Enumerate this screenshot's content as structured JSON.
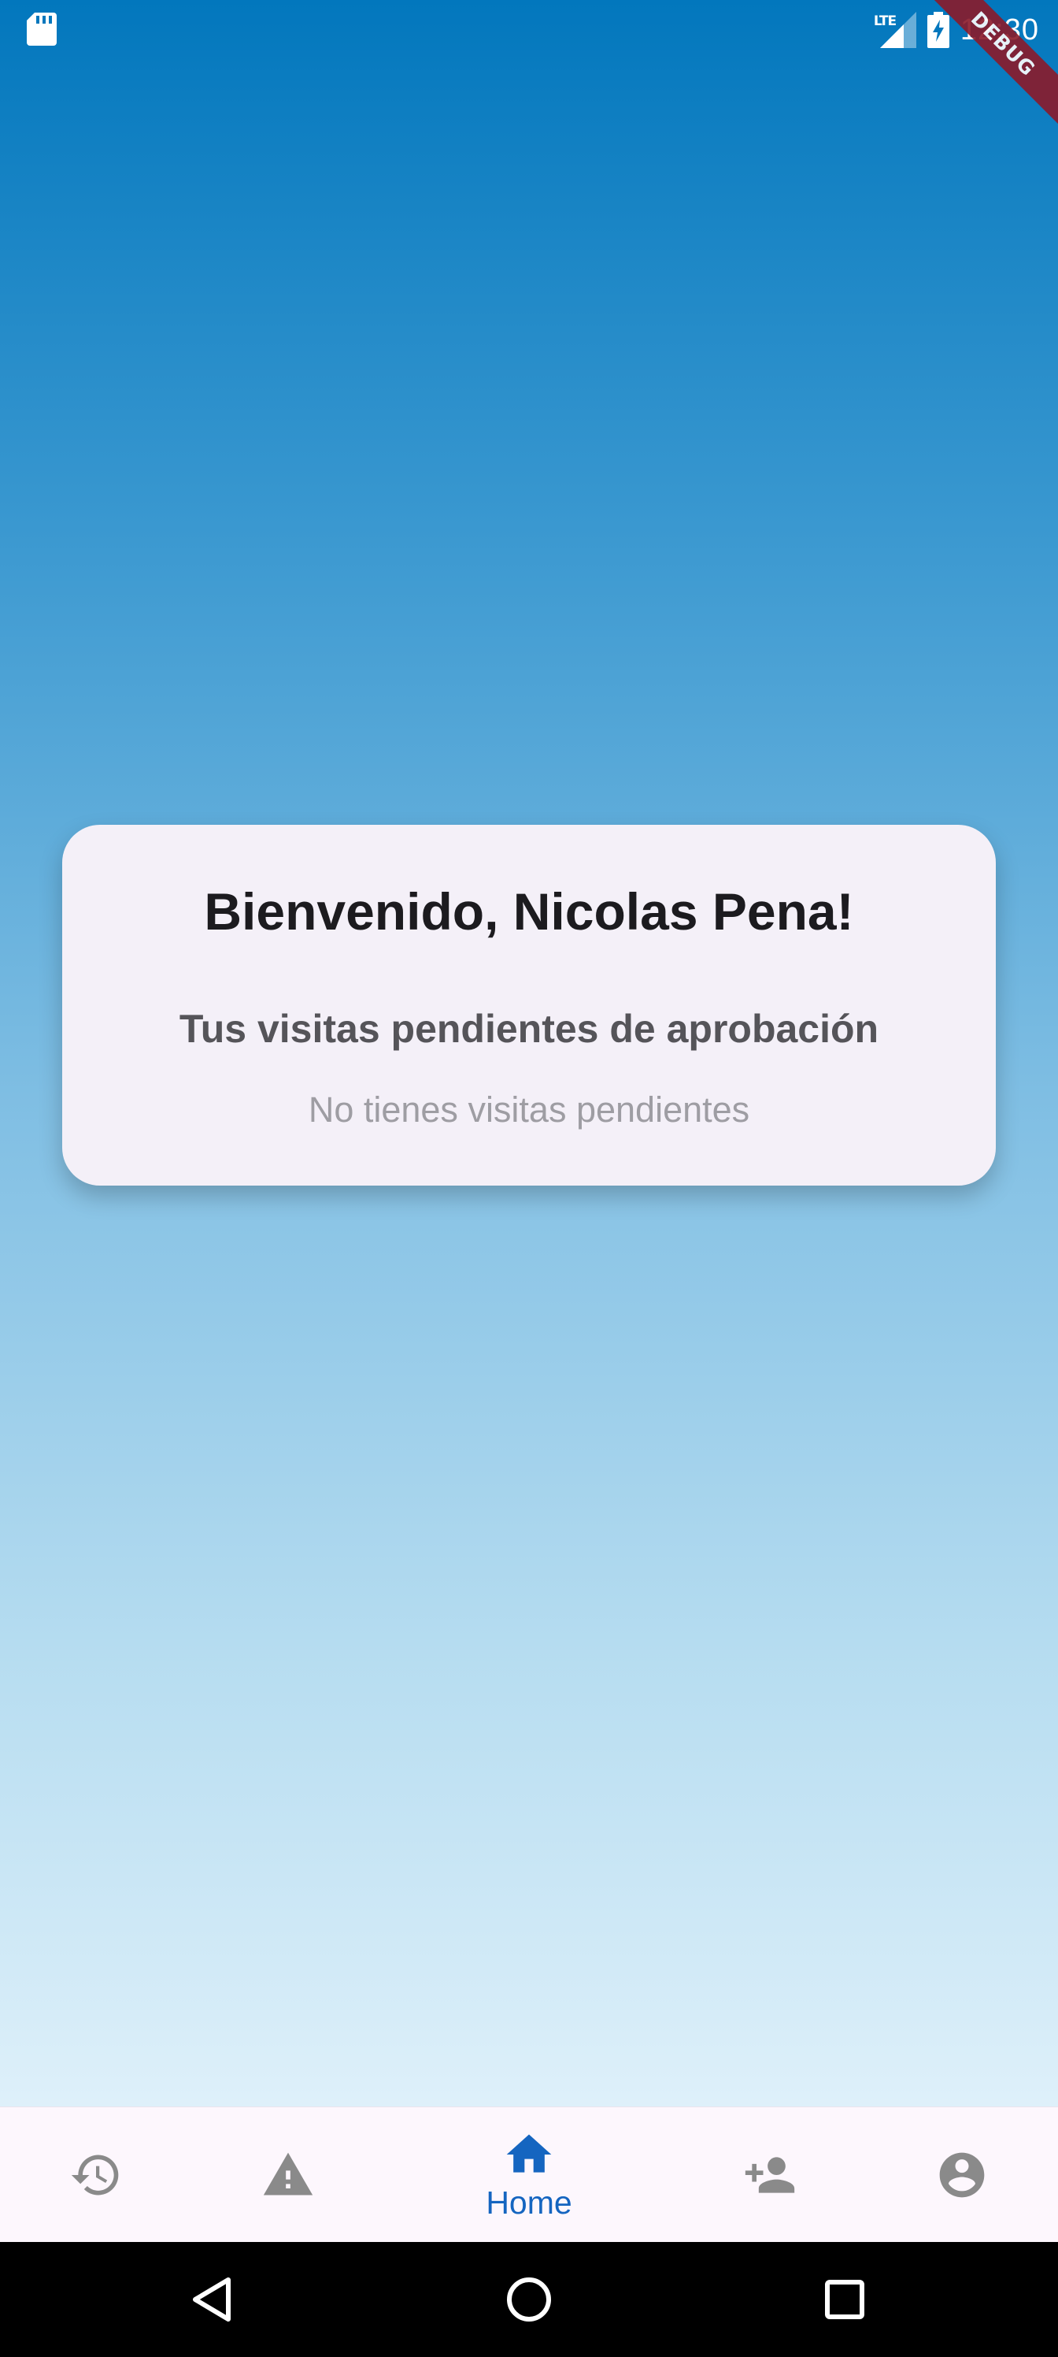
{
  "status_bar": {
    "time": "12:30",
    "network": "LTE",
    "debug_banner": "DEBUG"
  },
  "card": {
    "title": "Bienvenido, Nicolas Pena!",
    "pending_heading": "Tus visitas pendientes de aprobación",
    "pending_empty": "No tienes visitas pendientes"
  },
  "bottom_nav": {
    "items": [
      {
        "icon": "history-icon",
        "label": "",
        "active": false
      },
      {
        "icon": "warning-icon",
        "label": "",
        "active": false
      },
      {
        "icon": "home-icon",
        "label": "Home",
        "active": true
      },
      {
        "icon": "person-add-icon",
        "label": "",
        "active": false
      },
      {
        "icon": "account-circle-icon",
        "label": "",
        "active": false
      }
    ]
  },
  "system_nav": {
    "buttons": [
      "back",
      "home",
      "recents"
    ]
  },
  "colors": {
    "gradient_top": "#0277bd",
    "gradient_bottom": "#def0fa",
    "card_background": "#f4f0f8",
    "nav_active": "#1565c0",
    "nav_inactive": "#8a8a8a",
    "debug_banner": "#8b1a2a"
  }
}
